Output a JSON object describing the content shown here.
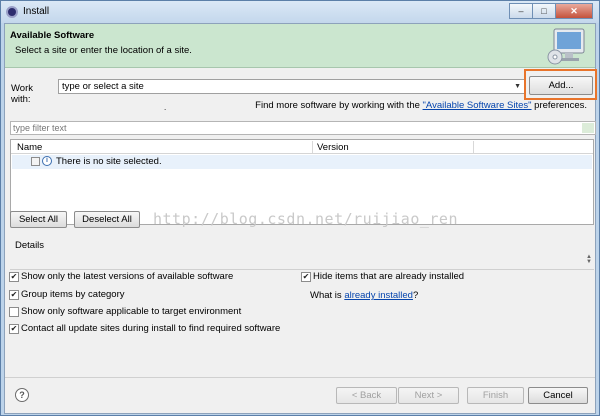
{
  "window": {
    "title": "Install"
  },
  "header": {
    "title": "Available Software",
    "description": "Select a site or enter the location of a site."
  },
  "work_with": {
    "label": "Work with:",
    "value": "type or select a site",
    "add_label": "Add..."
  },
  "find_more": {
    "prefix": "Find more software by working with the ",
    "link": "\"Available Software Sites\"",
    "suffix": " preferences."
  },
  "filter": {
    "placeholder": "type filter text"
  },
  "table": {
    "columns": [
      "Name",
      "Version"
    ],
    "rows": [
      {
        "text": "There is no site selected."
      }
    ]
  },
  "buttons": {
    "select_all": "Select All",
    "deselect_all": "Deselect All",
    "back": "< Back",
    "next": "Next >",
    "finish": "Finish",
    "cancel": "Cancel"
  },
  "watermark": "http://blog.csdn.net/ruijiao_ren",
  "details": {
    "label": "Details"
  },
  "options": {
    "latest_versions": {
      "label": "Show only the latest versions of available software",
      "checked": true
    },
    "group_by_category": {
      "label": "Group items by category",
      "checked": true
    },
    "applicable_only": {
      "label": "Show only software applicable to target environment",
      "checked": false
    },
    "contact_sites": {
      "label": "Contact all update sites during install to find required software",
      "checked": true
    },
    "hide_installed": {
      "label": "Hide items that are already installed",
      "checked": true
    }
  },
  "what_is": {
    "prefix": "What is ",
    "link": "already installed",
    "suffix": "?"
  },
  "colors": {
    "header_bg": "#cbe6cf",
    "highlight": "#e8742b",
    "link": "#0645ad"
  }
}
